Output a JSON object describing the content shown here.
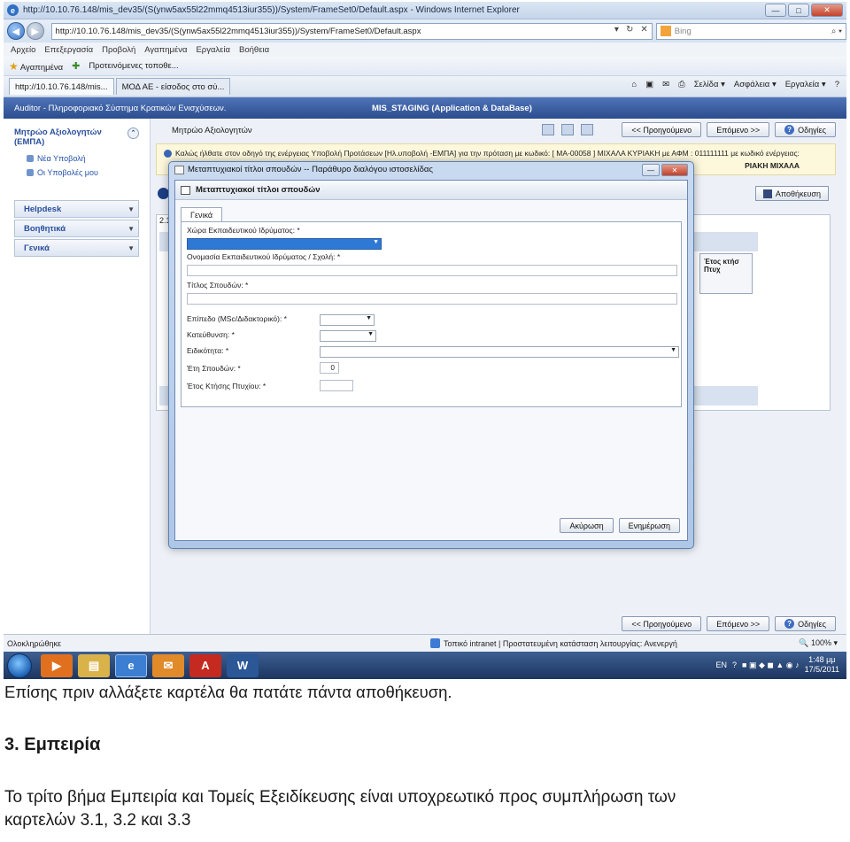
{
  "browser": {
    "window_title": "http://10.10.76.148/mis_dev35/(S(ynw5ax55l22mmq4513iur355))/System/FrameSet0/Default.aspx - Windows Internet Explorer",
    "window_controls": [
      "—",
      "□",
      "✕"
    ],
    "address": "http://10.10.76.148/mis_dev35/(S(ynw5ax55l22mmq4513iur355))/System/FrameSet0/Default.aspx",
    "search_placeholder": "Bing",
    "menu": [
      "Αρχείο",
      "Επεξεργασία",
      "Προβολή",
      "Αγαπημένα",
      "Εργαλεία",
      "Βοήθεια"
    ],
    "favorites_label": "Αγαπημένα",
    "suggested_sites": "Προτεινόμενες τοποθε...",
    "tabs": [
      {
        "label": "http://10.10.76.148/mis..."
      },
      {
        "label": "ΜΟΔ ΑΕ - είσοδος στο σύ..."
      }
    ],
    "commands": [
      "Σελίδα ▾",
      "Ασφάλεια ▾",
      "Εργαλεία ▾"
    ],
    "status_left": "Ολοκληρώθηκε",
    "status_zone": "Τοπικό intranet | Προστατευμένη κατάσταση λειτουργίας: Ανενεργή",
    "zoom": "100%"
  },
  "app": {
    "header_left": "Auditor - Πληροφοριακό Σύστημα Κρατικών Ενισχύσεων.",
    "header_center": "MIS_STAGING (Application & DataBase)",
    "sidebar": {
      "title": "Μητρώο Αξιολογητών (ΕΜΠΑ)",
      "links": [
        "Νέα Υποβολή",
        "Οι Υποβολές μου"
      ],
      "sections": [
        "Helpdesk",
        "Βοηθητικά",
        "Γενικά"
      ]
    },
    "main": {
      "page_title": "Μητρώο Αξιολογητών",
      "prev_label": "<< Προηγούμενο",
      "next_label": "Επόμενο >>",
      "help_label": "Οδηγίες",
      "info_text": "Καλώς ήλθατε στον οδηγό της ενέργειας Υποβολή Προτάσεων [Ηλ.υποβολή -ΕΜΠΑ] για την πρόταση με κωδικό: [ ΜΑ-00058 ] ΜΙΧΑΛΑ ΚΥΡΙΑΚΗ με ΑΦΜ : 011111111 με κωδικό ενέργειας:",
      "info_text2": "ΡΙΑΚΗ ΜΙΧΑΛΑ",
      "save_label": "Αποθήκευση",
      "section_no": "2.1",
      "col_header": "Έτος κτήσ Πτυχ"
    }
  },
  "dialog": {
    "window_title": "Μεταπτυχιακοί τίτλοι σπουδών -- Παράθυρο διαλόγου ιστοσελίδας",
    "heading": "Μεταπτυχιακοί τίτλοι σπουδών",
    "tab": "Γενικά",
    "fields": {
      "country": "Χώρα Εκπαιδευτικού Ιδρύματος: *",
      "institution": "Ονομασία Εκπαιδευτικού Ιδρύματος / Σχολή: *",
      "title": "Τίτλος Σπουδών: *",
      "level": "Επίπεδο (MSc/Διδακτορικό): *",
      "direction": "Κατεύθυνση: *",
      "specialty": "Ειδικότητα: *",
      "years": "Έτη Σπουδών: *",
      "year_obtained": "Έτος Κτήσης Πτυχίου: *"
    },
    "years_value": "0",
    "cancel_label": "Ακύρωση",
    "update_label": "Ενημέρωση"
  },
  "taskbar": {
    "lang": "EN",
    "time": "1:48 μμ",
    "date": "17/5/2011"
  },
  "document": {
    "line1": "Επίσης πριν αλλάξετε καρτέλα θα πατάτε πάντα αποθήκευση.",
    "heading": "3. Εμπειρία",
    "para_line1": "Το τρίτο βήμα Εμπειρία και Τομείς Εξειδίκευσης είναι υποχρεωτικό προς συμπλήρωση των",
    "para_line2": "καρτελών 3.1, 3.2 και 3.3"
  }
}
